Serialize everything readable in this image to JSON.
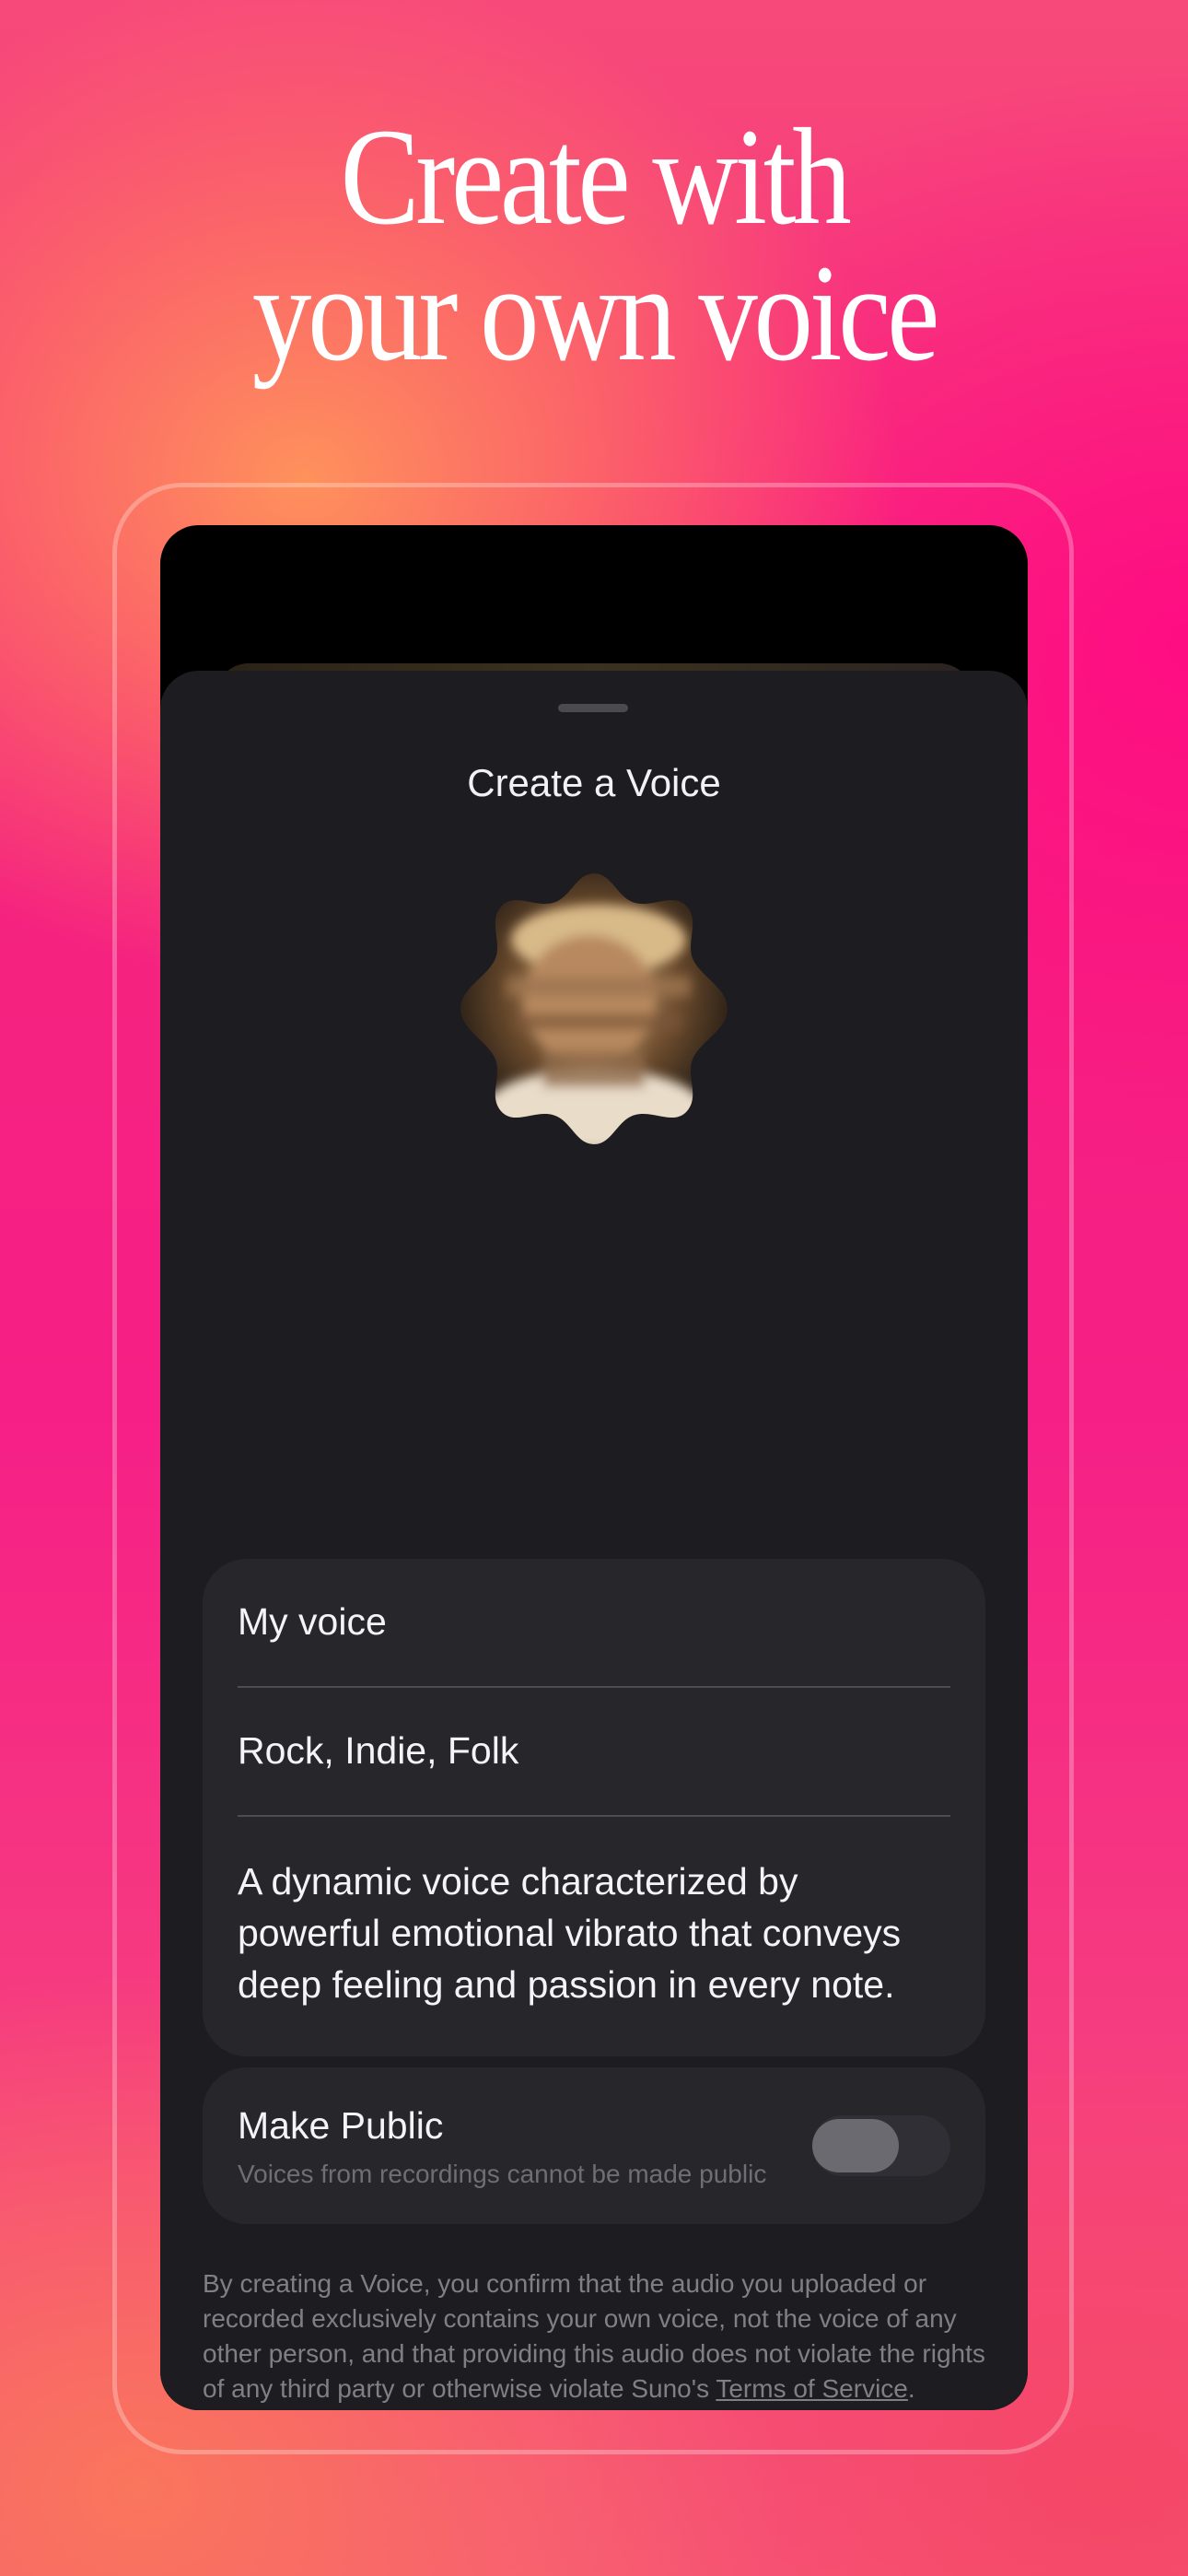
{
  "headline": {
    "line1": "Create with",
    "line2": "your own voice"
  },
  "sheet": {
    "title": "Create a Voice",
    "avatar_icon": "voice-avatar-blurred-portrait"
  },
  "details": {
    "name": "My voice",
    "styles": "Rock, Indie, Folk",
    "description": "A dynamic voice characterized by powerful emotional vibrato that conveys deep feeling and passion in every note."
  },
  "make_public": {
    "label": "Make Public",
    "hint": "Voices from recordings cannot be made public",
    "enabled": false
  },
  "legal": {
    "text": "By creating a Voice, you confirm that the audio you uploaded or recorded exclusively contains your own voice, not the voice of any other person, and that providing this audio does not violate the rights of any third party or otherwise violate Suno's ",
    "link": "Terms of Service",
    "end": "."
  },
  "colors": {
    "sheet_bg": "#1d1d21",
    "card_bg": "#26262b",
    "accent_pink": "#f61f86",
    "accent_orange": "#f7885a"
  }
}
